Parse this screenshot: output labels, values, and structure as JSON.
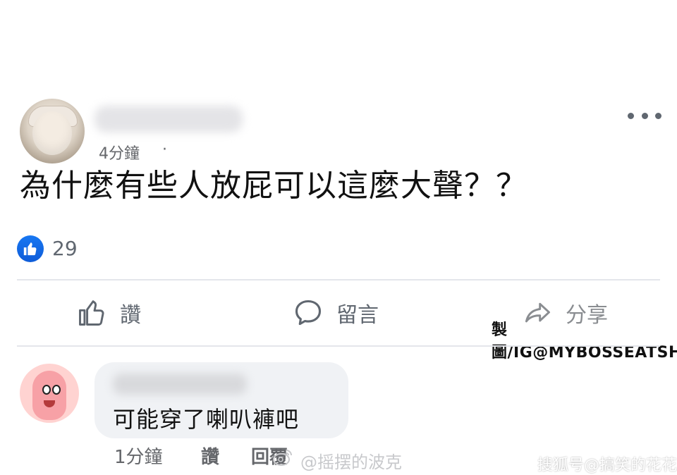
{
  "post": {
    "time": "4分鐘",
    "privacy_dot": "·",
    "text": "為什麼有些人放屁可以這麼大聲？？",
    "like_count": "29",
    "more_icon": "more-horizontal-icon"
  },
  "actions": {
    "like_label": "讚",
    "comment_label": "留言",
    "share_label": "分享",
    "like_icon": "thumbs-up-icon",
    "comment_icon": "comment-bubble-icon",
    "share_icon": "share-arrow-icon"
  },
  "watermark_credit": "製圖/IG@MYBOSSEATSHIT",
  "comment": {
    "text": "可能穿了喇叭褲吧",
    "time": "1分鐘",
    "like_label": "讚",
    "reply_label": "回覆"
  },
  "weibo_watermark": "@摇摆的波克",
  "sohu_watermark": "搜狐号@搞笑的花花",
  "colors": {
    "facebook_blue": "#1877f2",
    "text_gray": "#65676b",
    "bubble_bg": "#f0f2f5"
  }
}
